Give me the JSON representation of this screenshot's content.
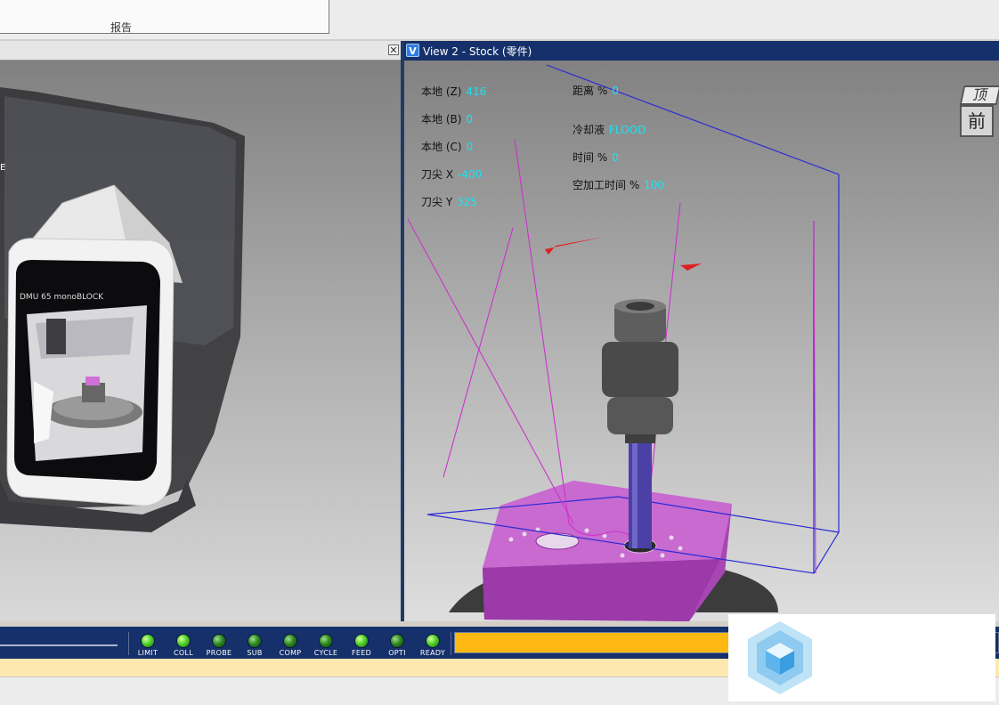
{
  "report": {
    "label": "报告"
  },
  "view1": {
    "close_glyph": "✕"
  },
  "view2": {
    "icon_letter": "V",
    "title": "View 2 - Stock (零件)",
    "readouts": [
      {
        "label": "本地 (Z)",
        "value": "416"
      },
      {
        "label": "本地 (B)",
        "value": "0"
      },
      {
        "label": "本地 (C)",
        "value": "0"
      },
      {
        "label": "刀尖 X",
        "value": "-400"
      },
      {
        "label": "刀尖 Y",
        "value": "325"
      },
      {
        "label": "距离 %",
        "value": "0"
      },
      {
        "label": "冷却液",
        "value": "FLOOD"
      },
      {
        "label": "时间 %",
        "value": "0"
      },
      {
        "label": "空加工时间 %",
        "value": "100"
      }
    ],
    "viewcube": {
      "top": "顶",
      "front": "前"
    }
  },
  "machine": {
    "brand_text": "DMU 65 monoBLOCK"
  },
  "status": {
    "leds": [
      {
        "label": "LIMIT",
        "state": "on"
      },
      {
        "label": "COLL",
        "state": "on"
      },
      {
        "label": "PROBE",
        "state": "dim"
      },
      {
        "label": "SUB",
        "state": "dim"
      },
      {
        "label": "COMP",
        "state": "dim"
      },
      {
        "label": "CYCLE",
        "state": "dim"
      },
      {
        "label": "FEED",
        "state": "on"
      },
      {
        "label": "OPTI",
        "state": "dim"
      },
      {
        "label": "READY",
        "state": "on"
      }
    ],
    "progress_fraction": 0.52
  },
  "colors": {
    "titlebar": "#15306a",
    "readout_value": "#1be3f2",
    "progress": "#fdb912",
    "part": "#b84fc0",
    "toolpath": "#cc33cc",
    "bounding_box": "#2b2bd6",
    "arrow": "#e02020"
  },
  "icons": [
    "close-icon",
    "vericut-view-icon",
    "view-cube-icon",
    "watermark-logo-icon"
  ]
}
